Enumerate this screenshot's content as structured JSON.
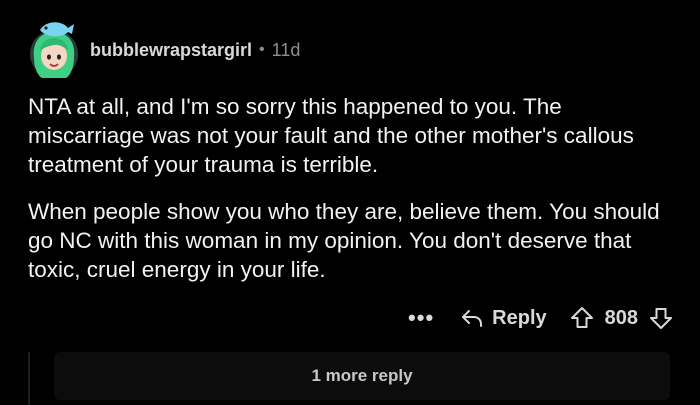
{
  "comment": {
    "author": "bubblewrapstargirl",
    "separator": "•",
    "age": "11d",
    "avatar_icon": "mermaid-avatar-icon",
    "paragraphs": [
      "NTA at all, and I'm so sorry this happened to you. The miscarriage was not your fault and the other mother's callous treatment of your trauma is terrible.",
      "When people show you who they are, believe them. You should go NC with this woman in my opinion. You don't deserve that toxic, cruel energy in your life."
    ]
  },
  "actions": {
    "more_label": "•••",
    "reply_label": "Reply",
    "vote_count": "808",
    "upvote_icon": "arrow-up-icon",
    "downvote_icon": "arrow-down-icon",
    "reply_icon": "reply-arrow-icon"
  },
  "replies": {
    "more_label": "1 more reply"
  },
  "colors": {
    "background": "#000000",
    "text": "#f2f2f2",
    "muted": "#8a8f93",
    "avatar_hair": "#3ecf85",
    "avatar_bg": "#2b3a3a"
  }
}
